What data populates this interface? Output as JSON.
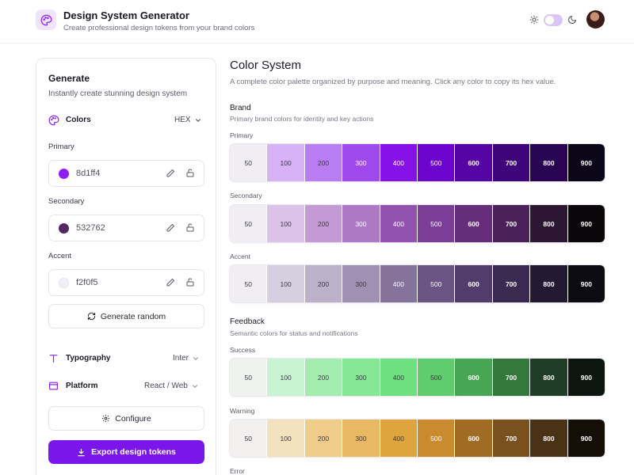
{
  "header": {
    "title": "Design System Generator",
    "subtitle": "Create professional design tokens from your brand colors"
  },
  "sidebar": {
    "title": "Generate",
    "subtitle": "Instantly create stunning design system",
    "colors_label": "Colors",
    "format_value": "HEX",
    "primary": {
      "label": "Primary",
      "hex": "8d1ff4",
      "color": "#8d1ff4"
    },
    "secondary": {
      "label": "Secondary",
      "hex": "532762",
      "color": "#532762"
    },
    "accent": {
      "label": "Accent",
      "hex": "f2f0f5",
      "color": "#f2f0f5"
    },
    "generate_random": "Generate random",
    "typography_label": "Typography",
    "typography_value": "Inter",
    "platform_label": "Platform",
    "platform_value": "React / Web",
    "configure": "Configure",
    "export": "Export design tokens"
  },
  "main": {
    "title": "Color System",
    "description": "A complete color palette organized by purpose and meaning. Click any color to copy its hex value.",
    "groups": [
      {
        "title": "Brand",
        "description": "Primary brand colors for identity and key actions",
        "scales": [
          {
            "name": "Primary",
            "shades": [
              "50",
              "100",
              "200",
              "300",
              "400",
              "500",
              "600",
              "700",
              "800",
              "900"
            ],
            "colors": [
              "#f0eef3",
              "#d7b3f5",
              "#b87ef1",
              "#9f48ec",
              "#8513e8",
              "#6c06cf",
              "#5405a3",
              "#3e047a",
              "#290453",
              "#0b0618"
            ]
          },
          {
            "name": "Secondary",
            "shades": [
              "50",
              "100",
              "200",
              "300",
              "400",
              "500",
              "600",
              "700",
              "800",
              "900"
            ],
            "colors": [
              "#f0eef3",
              "#dcc1e8",
              "#c49ad5",
              "#ad79c6",
              "#9352b0",
              "#7b3d96",
              "#642e7a",
              "#4b2159",
              "#2d1633",
              "#0a0609"
            ]
          },
          {
            "name": "Accent",
            "shades": [
              "50",
              "100",
              "200",
              "300",
              "400",
              "500",
              "600",
              "700",
              "800",
              "900"
            ],
            "colors": [
              "#f0eef3",
              "#d6cfdf",
              "#bcb1c9",
              "#a090b1",
              "#85739b",
              "#6b5583",
              "#523c6b",
              "#3a2950",
              "#231933",
              "#0d0b12"
            ]
          }
        ]
      },
      {
        "title": "Feedback",
        "description": "Semantic colors for status and notifications",
        "scales": [
          {
            "name": "Success",
            "shades": [
              "50",
              "100",
              "200",
              "300",
              "400",
              "500",
              "600",
              "700",
              "800",
              "900"
            ],
            "colors": [
              "#f0f2f0",
              "#c9f4d3",
              "#a4edb1",
              "#86e895",
              "#6fe07f",
              "#5fcc6d",
              "#47a653",
              "#32793b",
              "#203e25",
              "#0c150e"
            ]
          },
          {
            "name": "Warning",
            "shades": [
              "50",
              "100",
              "200",
              "300",
              "400",
              "500",
              "600",
              "700",
              "800",
              "900"
            ],
            "colors": [
              "#f2f0ee",
              "#f4e2be",
              "#f0cc8a",
              "#e9b862",
              "#e0a43f",
              "#c98b2d",
              "#a06c23",
              "#7a511c",
              "#4a3216",
              "#140e07"
            ]
          }
        ]
      }
    ],
    "next_label": "Error"
  }
}
